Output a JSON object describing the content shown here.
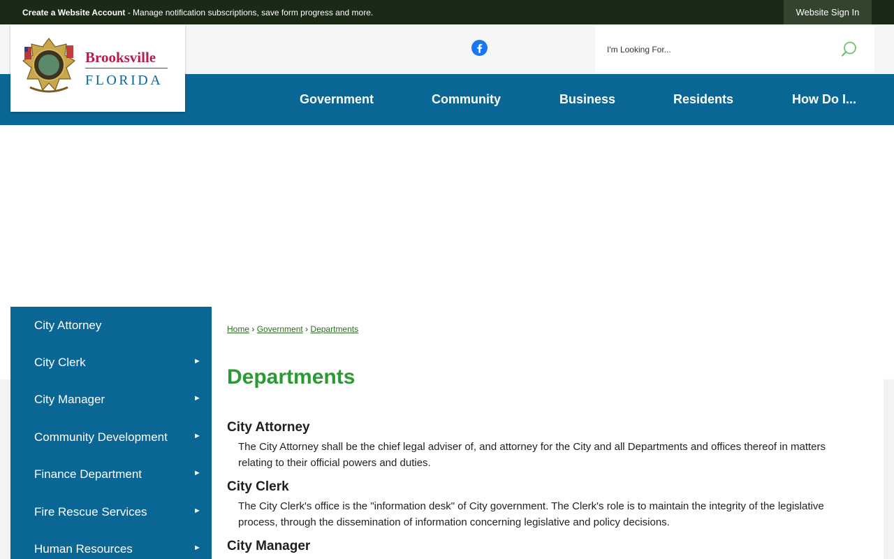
{
  "topbar": {
    "account_link": "Create a Website Account",
    "account_text": " - Manage notification subscriptions, save form progress and more.",
    "signin_label": "Website Sign In"
  },
  "logo": {
    "name": "Brooksville",
    "state": "FLORIDA"
  },
  "search": {
    "placeholder": "I'm Looking For..."
  },
  "nav": {
    "items": [
      {
        "label": "Government"
      },
      {
        "label": "Community"
      },
      {
        "label": "Business"
      },
      {
        "label": "Residents"
      },
      {
        "label": "How Do I..."
      }
    ]
  },
  "sidebar": {
    "items": [
      {
        "label": "City Attorney",
        "arrow": ""
      },
      {
        "label": "City Clerk",
        "arrow": "►"
      },
      {
        "label": "City Manager",
        "arrow": "►"
      },
      {
        "label": "Community Development",
        "arrow": "►"
      },
      {
        "label": "Finance Department",
        "arrow": "►"
      },
      {
        "label": "Fire Rescue Services",
        "arrow": "►"
      },
      {
        "label": "Human Resources",
        "arrow": "►"
      }
    ]
  },
  "breadcrumb": {
    "home": "Home",
    "government": "Government",
    "departments": "Departments",
    "separator": "›"
  },
  "page": {
    "title": "Departments"
  },
  "departments": [
    {
      "name": "City Attorney",
      "description": "The City Attorney shall be the chief legal adviser of, and attorney for the City and all Departments and offices thereof in matters relating to their official powers and duties."
    },
    {
      "name": "City Clerk",
      "description": "The City Clerk's office is the \"information desk\" of City government. The Clerk's role is to maintain the integrity of the legislative process, through the dissemination of information concerning legislative and policy decisions."
    },
    {
      "name": "City Manager",
      "description": ""
    }
  ],
  "colors": {
    "nav_blue": "#0a6694",
    "topbar": "#1b2a17",
    "title_green": "#2a9a32",
    "brand_red": "#b51e4a"
  },
  "icons": {
    "social": "facebook-icon",
    "search": "search-icon",
    "submenu": "triangle-right-icon"
  }
}
